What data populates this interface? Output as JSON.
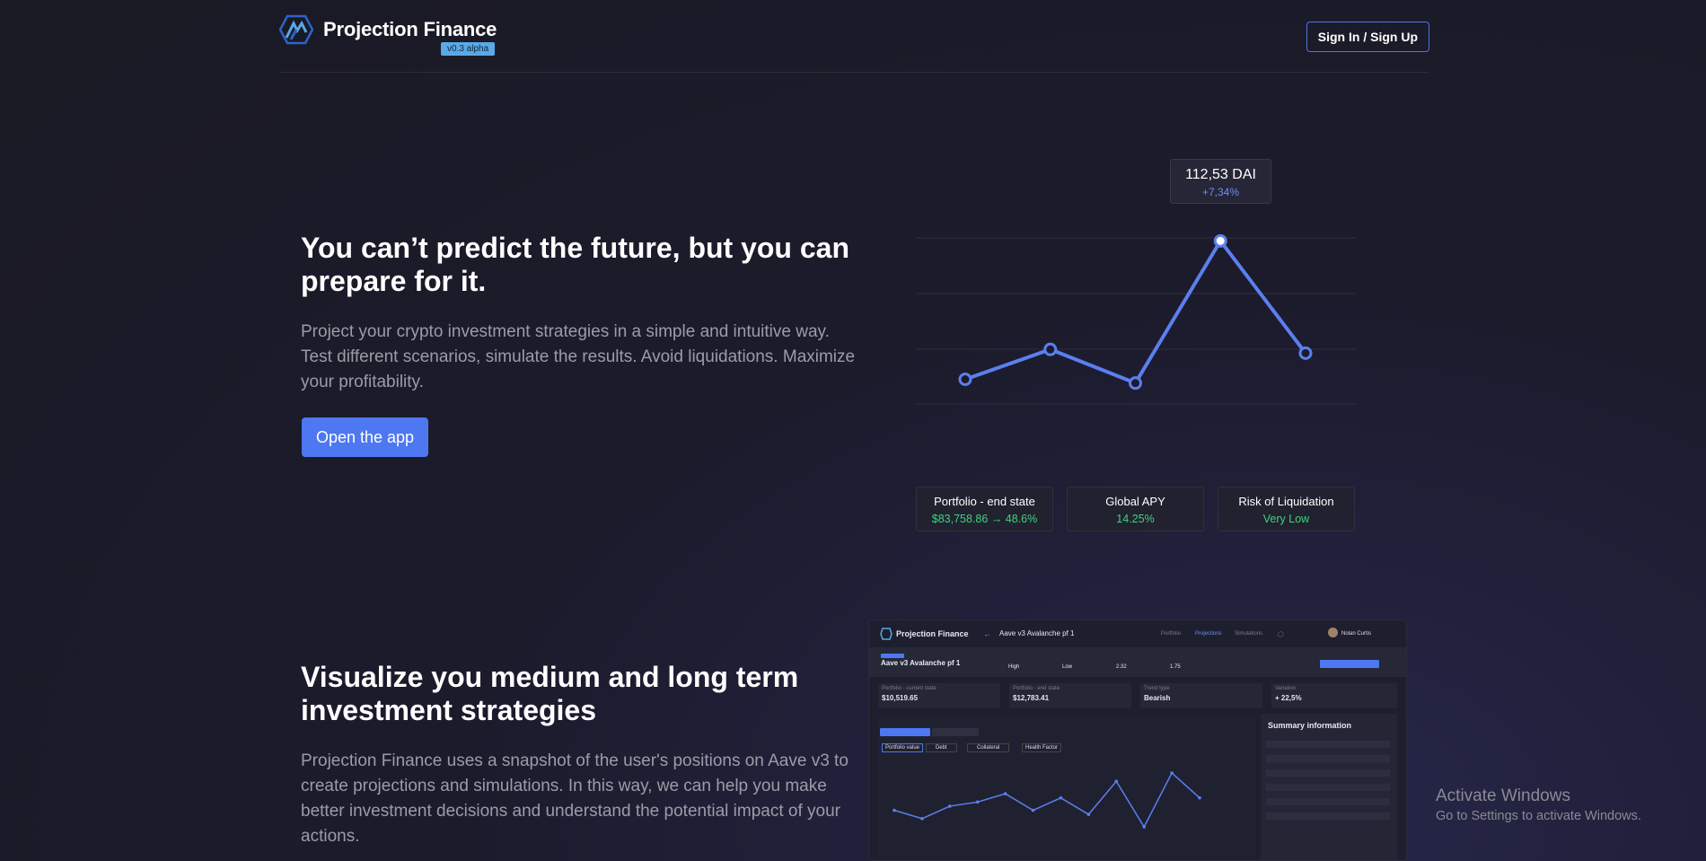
{
  "header": {
    "brand": "Projection Finance",
    "version": "v0.3 alpha",
    "signin_label": "Sign In / Sign Up"
  },
  "hero": {
    "title": "You can’t predict the future, but you can prepare for it.",
    "description": "Project your crypto investment strategies in a simple and intuitive way. Test different scenarios, simulate the results. Avoid liquidations. Maximize your profitability.",
    "cta_label": "Open the app"
  },
  "hero_chart": {
    "tooltip_value": "112,53 DAI",
    "tooltip_change": "+7,34%",
    "line_color": "#5b7ff0"
  },
  "chart_data": {
    "type": "line",
    "x": [
      1,
      2,
      3,
      4,
      5
    ],
    "series": [
      {
        "values": [
          29,
          37,
          28,
          66,
          36
        ]
      }
    ],
    "ylim": [
      20,
      80
    ],
    "grid": true
  },
  "stats": [
    {
      "title": "Portfolio - end state",
      "value": "$83,758.86  →  48.6%"
    },
    {
      "title": "Global APY",
      "value": "14.25%"
    },
    {
      "title": "Risk of  Liquidation",
      "value": "Very Low"
    }
  ],
  "section2": {
    "title": "Visualize you medium and long term investment strategies",
    "description": "Projection Finance uses a snapshot of the user's positions on Aave v3 to create projections and simulations. In this way, we can help you make better investment decisions and understand the potential impact of your actions."
  },
  "preview": {
    "brand": "Projection Finance",
    "page": "Aave v3 Avalanche pf 1",
    "nav": [
      "Portfolio",
      "Projections",
      "Simulations"
    ],
    "user": "Nolan Curtis",
    "title": "Aave v3 Avalanche pf 1",
    "risk": "High",
    "volatility": "Low",
    "collateral": "2.32",
    "health": "1.75",
    "cards": [
      {
        "label": "Portfolio - current state",
        "value": "$10,519.65"
      },
      {
        "label": "Portfolio - end state",
        "value": "$12,783.41"
      },
      {
        "label": "Trend type",
        "value": "Bearish"
      },
      {
        "label": "Variation",
        "value": "+ 22,5%"
      }
    ],
    "tabs": [
      "Portfolio value",
      "Debt",
      "Collateral",
      "Health Factor"
    ],
    "summary_title": "Summary information",
    "chart_values": [
      5,
      3,
      6,
      7,
      9,
      5,
      8,
      4,
      12,
      1,
      14,
      8
    ]
  },
  "watermark": {
    "line1": "Activate Windows",
    "line2": "Go to Settings to activate Windows."
  }
}
